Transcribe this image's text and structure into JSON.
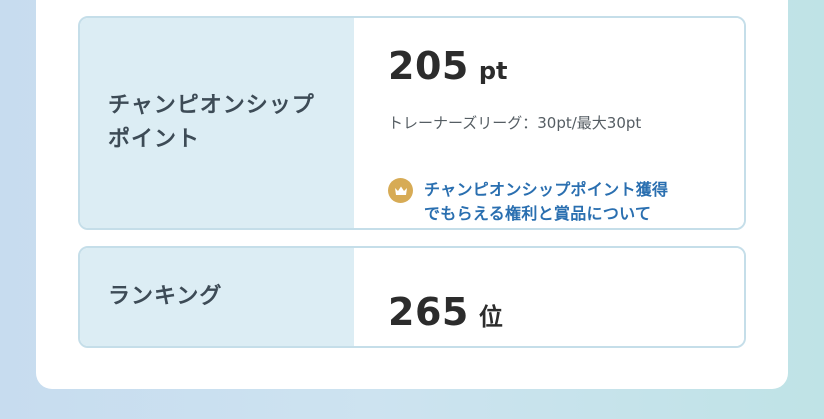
{
  "championship": {
    "label": "チャンピオンシップ\nポイント",
    "points": "205",
    "points_unit": "pt",
    "note": "トレーナーズリーグ：30pt/最大30pt",
    "link_icon": "crown-icon",
    "link_text": "チャンピオンシップポイント獲得\nでもらえる権利と賞品について"
  },
  "ranking": {
    "label": "ランキング",
    "value": "265",
    "unit": "位"
  },
  "colors": {
    "label_bg": "#dcedf4",
    "border": "#c5dee9",
    "link": "#2a6fb0",
    "crown_badge": "#d7ab55"
  }
}
